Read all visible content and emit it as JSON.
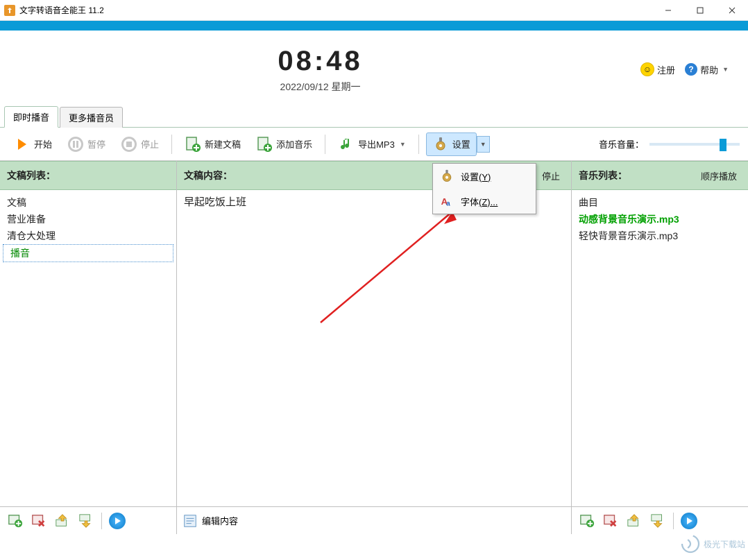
{
  "window": {
    "title": "文字转语音全能王 11.2"
  },
  "clock": {
    "time": "08:48",
    "date": "2022/09/12 星期一"
  },
  "header_buttons": {
    "register": "注册",
    "help": "帮助"
  },
  "tabs": {
    "tab1": "即时播音",
    "tab2": "更多播音员"
  },
  "toolbar": {
    "start": "开始",
    "pause": "暂停",
    "stop": "停止",
    "new_doc": "新建文稿",
    "add_music": "添加音乐",
    "export_mp3": "导出MP3",
    "settings": "设置",
    "volume_label": "音乐音量："
  },
  "columns": {
    "docs_header": "文稿列表：",
    "content_header": "文稿内容：",
    "content_stop": "停止",
    "music_header": "音乐列表：",
    "music_mode": "顺序播放"
  },
  "docs": {
    "col_title": "文稿",
    "items": [
      "营业准备",
      "清仓大处理",
      "播音"
    ]
  },
  "content_text": "早起吃饭上班",
  "music": {
    "col_title": "曲目",
    "items": [
      "动感背景音乐演示.mp3",
      "轻快背景音乐演示.mp3"
    ]
  },
  "bottom": {
    "edit_content": "编辑内容"
  },
  "dropdown": {
    "item1_label": "设置",
    "item1_key": "(Y)",
    "item2_label": "字体",
    "item2_key": "(Z)..."
  },
  "watermark": "极光下载站"
}
